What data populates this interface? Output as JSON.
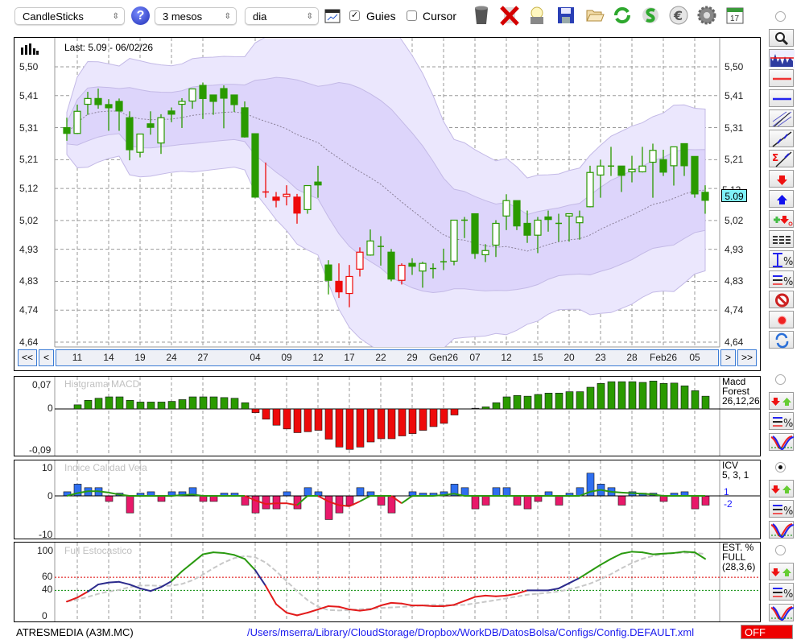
{
  "toolbar": {
    "chart_type": "CandleSticks",
    "period": "3 mesos",
    "interval": "dia",
    "guides_label": "Guies",
    "guides_checked": true,
    "cursor_label": "Cursor",
    "cursor_checked": false
  },
  "main": {
    "last_label": "Last: 5.09 - 06/02/26",
    "current_price": "5.09",
    "hidden_price": "5.12",
    "price_ticks": [
      "5,50",
      "5,41",
      "5,31",
      "5,21",
      "5,12",
      "5,02",
      "4,93",
      "4,83",
      "4,74",
      "4,64"
    ],
    "price_tick_values": [
      5.5,
      5.41,
      5.31,
      5.21,
      5.12,
      5.02,
      4.93,
      4.83,
      4.74,
      4.64
    ],
    "price_range": [
      4.64,
      5.5
    ],
    "colors": {
      "up": "#2a9a00",
      "down": "#ee0a0a",
      "band_outer": "#ebe7fd",
      "band_inner": "#ddd5fb",
      "band_edge": "#c3b9e6",
      "ma": "#8a8098",
      "price_box": "#7ff0f8"
    },
    "candles": [
      [
        5.31,
        5.341,
        5.269,
        5.292,
        "g"
      ],
      [
        5.292,
        5.382,
        5.29,
        5.361,
        "g"
      ],
      [
        5.383,
        5.422,
        5.35,
        5.401,
        "g"
      ],
      [
        5.401,
        5.432,
        5.369,
        5.382,
        "g"
      ],
      [
        5.382,
        5.399,
        5.3,
        5.372,
        "g"
      ],
      [
        5.392,
        5.401,
        5.3,
        5.362,
        "g"
      ],
      [
        5.341,
        5.361,
        5.208,
        5.241,
        "g"
      ],
      [
        5.233,
        5.29,
        5.217,
        5.29,
        "g"
      ],
      [
        5.322,
        5.361,
        5.288,
        5.311,
        "g"
      ],
      [
        5.262,
        5.352,
        5.228,
        5.341,
        "g"
      ],
      [
        5.362,
        5.373,
        5.327,
        5.352,
        "g"
      ],
      [
        5.383,
        5.402,
        5.309,
        5.392,
        "g"
      ],
      [
        5.393,
        5.431,
        5.369,
        5.431,
        "g"
      ],
      [
        5.442,
        5.451,
        5.337,
        5.401,
        "g"
      ],
      [
        5.412,
        5.412,
        5.35,
        5.392,
        "g"
      ],
      [
        5.432,
        5.442,
        5.308,
        5.402,
        "g"
      ],
      [
        5.412,
        5.412,
        5.359,
        5.382,
        "g"
      ],
      [
        5.372,
        5.392,
        5.279,
        5.281,
        "g"
      ],
      [
        5.291,
        5.291,
        5.091,
        5.093,
        "g"
      ],
      [
        5.109,
        5.201,
        5.091,
        5.109,
        "r"
      ],
      [
        5.093,
        5.109,
        5.061,
        5.083,
        "r"
      ],
      [
        5.095,
        5.13,
        5.067,
        5.102,
        "r"
      ],
      [
        5.093,
        5.103,
        5.01,
        5.043,
        "r"
      ],
      [
        5.054,
        5.129,
        5.041,
        5.129,
        "g"
      ],
      [
        5.14,
        5.191,
        5.091,
        5.131,
        "g"
      ],
      [
        4.881,
        4.896,
        4.789,
        4.833,
        "g"
      ],
      [
        4.83,
        4.886,
        4.778,
        4.797,
        "r"
      ],
      [
        4.792,
        4.881,
        4.749,
        4.845,
        "r"
      ],
      [
        4.868,
        4.936,
        4.845,
        4.921,
        "r"
      ],
      [
        4.912,
        4.992,
        4.91,
        4.956,
        "g"
      ],
      [
        4.939,
        4.971,
        4.879,
        4.939,
        "g"
      ],
      [
        4.921,
        4.931,
        4.83,
        4.837,
        "g"
      ],
      [
        4.833,
        4.886,
        4.82,
        4.88,
        "r"
      ],
      [
        4.886,
        4.902,
        4.85,
        4.877,
        "g"
      ],
      [
        4.862,
        4.891,
        4.81,
        4.886,
        "g"
      ],
      [
        4.87,
        4.886,
        4.839,
        4.87,
        "g"
      ],
      [
        4.891,
        4.932,
        4.865,
        4.891,
        "g"
      ],
      [
        4.893,
        5.021,
        4.88,
        5.021,
        "g"
      ],
      [
        5.021,
        5.031,
        4.965,
        5.021,
        "g"
      ],
      [
        5.041,
        5.041,
        4.9,
        4.917,
        "g"
      ],
      [
        4.913,
        4.946,
        4.89,
        4.926,
        "g"
      ],
      [
        4.943,
        5.021,
        4.906,
        5.011,
        "g"
      ],
      [
        5.034,
        5.102,
        4.99,
        5.082,
        "g"
      ],
      [
        5.082,
        5.082,
        4.99,
        5.003,
        "g"
      ],
      [
        5.011,
        5.051,
        4.95,
        4.974,
        "g"
      ],
      [
        4.974,
        5.031,
        4.918,
        5.021,
        "g"
      ],
      [
        5.031,
        5.051,
        4.985,
        5.023,
        "g"
      ],
      [
        5.011,
        5.041,
        4.954,
        5.011,
        "g"
      ],
      [
        5.034,
        5.041,
        4.954,
        5.041,
        "g"
      ],
      [
        5.013,
        5.051,
        4.96,
        5.031,
        "g"
      ],
      [
        5.063,
        5.191,
        5.061,
        5.17,
        "g"
      ],
      [
        5.162,
        5.21,
        5.091,
        5.19,
        "g"
      ],
      [
        5.19,
        5.25,
        5.159,
        5.19,
        "g"
      ],
      [
        5.19,
        5.19,
        5.109,
        5.161,
        "g"
      ],
      [
        5.172,
        5.222,
        5.139,
        5.18,
        "g"
      ],
      [
        5.172,
        5.25,
        5.17,
        5.19,
        "g"
      ],
      [
        5.202,
        5.26,
        5.091,
        5.239,
        "g"
      ],
      [
        5.21,
        5.241,
        5.159,
        5.171,
        "g"
      ],
      [
        5.191,
        5.25,
        5.129,
        5.25,
        "g"
      ],
      [
        5.26,
        5.26,
        5.159,
        5.191,
        "g"
      ],
      [
        5.22,
        5.22,
        5.091,
        5.103,
        "g"
      ],
      [
        5.108,
        5.13,
        5.041,
        5.083,
        "g"
      ]
    ],
    "date_labels": [
      {
        "label": "11",
        "index": 1
      },
      {
        "label": "14",
        "index": 4
      },
      {
        "label": "19",
        "index": 7
      },
      {
        "label": "24",
        "index": 10
      },
      {
        "label": "27",
        "index": 13
      },
      {
        "label": "04",
        "index": 18
      },
      {
        "label": "09",
        "index": 21
      },
      {
        "label": "12",
        "index": 24
      },
      {
        "label": "17",
        "index": 27
      },
      {
        "label": "22",
        "index": 30
      },
      {
        "label": "29",
        "index": 33
      },
      {
        "label": "Gen26",
        "index": 36
      },
      {
        "label": "07",
        "index": 39
      },
      {
        "label": "12",
        "index": 42
      },
      {
        "label": "15",
        "index": 45
      },
      {
        "label": "20",
        "index": 48
      },
      {
        "label": "23",
        "index": 51
      },
      {
        "label": "28",
        "index": 54
      },
      {
        "label": "Feb26",
        "index": 57
      },
      {
        "label": "05",
        "index": 60
      }
    ]
  },
  "nav": {
    "first": "<<",
    "prev": "<",
    "next": ">",
    "last": ">>"
  },
  "macd": {
    "title": "Histgrama MACD",
    "label_lines": [
      "Macd",
      "Forest",
      "26,12,26"
    ],
    "axis_top": "0,07",
    "axis_zero": "0",
    "axis_bottom": "-0,09",
    "range": [
      -0.09,
      0.07
    ],
    "values": [
      0,
      0.012,
      0.025,
      0.031,
      0.035,
      0.035,
      0.025,
      0.02,
      0.02,
      0.02,
      0.022,
      0.027,
      0.035,
      0.035,
      0.035,
      0.033,
      0.031,
      0.018,
      -0.008,
      -0.022,
      -0.035,
      -0.043,
      -0.051,
      -0.049,
      -0.046,
      -0.065,
      -0.082,
      -0.087,
      -0.082,
      -0.071,
      -0.064,
      -0.064,
      -0.058,
      -0.053,
      -0.046,
      -0.038,
      -0.031,
      -0.013,
      0,
      0.002,
      0.006,
      0.018,
      0.035,
      0.039,
      0.037,
      0.042,
      0.046,
      0.046,
      0.05,
      0.05,
      0.063,
      0.074,
      0.079,
      0.079,
      0.079,
      0.077,
      0.081,
      0.074,
      0.075,
      0.067,
      0.053,
      0.037
    ]
  },
  "icv": {
    "title": "Indice Calidad Vela",
    "label_lines": [
      "ICV",
      "5, 3, 1"
    ],
    "level_up": "1",
    "level_down": "-2",
    "axis_top": "10",
    "axis_zero": "0",
    "axis_bottom": "-10",
    "range": [
      -10,
      10
    ],
    "bars": [
      1.5,
      4.3,
      3,
      3,
      -1.5,
      1,
      -4.6,
      1,
      1.5,
      -1.5,
      1.5,
      1.5,
      3,
      -1.5,
      -1.5,
      1,
      1,
      -2.5,
      -4.6,
      -3.5,
      -3.5,
      1.5,
      -3.5,
      3,
      1.5,
      -6.4,
      -4.6,
      -2.5,
      3,
      1.5,
      -2.5,
      -4.6,
      0,
      1.5,
      1,
      1,
      1.5,
      4.3,
      3,
      -3.5,
      -2.5,
      3,
      3,
      -2.5,
      -3.5,
      -1.5,
      1.5,
      -2.5,
      1,
      3,
      8.3,
      4.3,
      3,
      -2.5,
      1.5,
      1,
      1,
      -1.5,
      1,
      1.5,
      -3.5,
      -2.5
    ],
    "line": [
      0,
      1,
      1.7,
      1.7,
      1.2,
      0.5,
      0,
      0,
      0,
      0,
      0,
      0.3,
      0.5,
      0,
      0,
      0,
      0,
      0,
      -1.2,
      -2.2,
      -2,
      -2,
      -2.5,
      0,
      0,
      -1.5,
      -2.5,
      -2.8,
      -1.5,
      0,
      0,
      0,
      -2,
      0,
      0,
      0,
      0.3,
      0.8,
      0,
      0,
      0,
      0,
      0,
      0,
      0,
      0,
      0,
      0,
      0,
      0,
      1.5,
      2.2,
      1.5,
      1.2,
      1,
      0.8,
      0.5,
      0,
      0,
      0,
      0,
      0
    ]
  },
  "stoch": {
    "title": "Full Estocastico",
    "label_lines": [
      "EST. %",
      "FULL",
      "(28,3,6)"
    ],
    "axis_labels": [
      "100",
      "60",
      "40",
      "0"
    ],
    "axis_values": [
      100,
      60,
      40,
      0
    ],
    "levels": [
      60,
      40
    ],
    "k": [
      23,
      29,
      38,
      49,
      52,
      53,
      49,
      43,
      39,
      45,
      54,
      69,
      82,
      95,
      98,
      97,
      94,
      88,
      71,
      47,
      19,
      6,
      2,
      6,
      11,
      16,
      15,
      11,
      9,
      11,
      17,
      21,
      20,
      17,
      17,
      16,
      16,
      18,
      24,
      30,
      32,
      31,
      32,
      35,
      40,
      40,
      40,
      43,
      51,
      59,
      69,
      79,
      88,
      96,
      99,
      98,
      95,
      96,
      97,
      99,
      98,
      88
    ]
  },
  "footer": {
    "symbol": "ATRESMEDIA (A3M.MC)",
    "config_path": "/Users/mserra/Library/CloudStorage/Dropbox/WorkDB/DatosBolsa/Configs/Config.DEFAULT.xml",
    "status": "OFF"
  }
}
